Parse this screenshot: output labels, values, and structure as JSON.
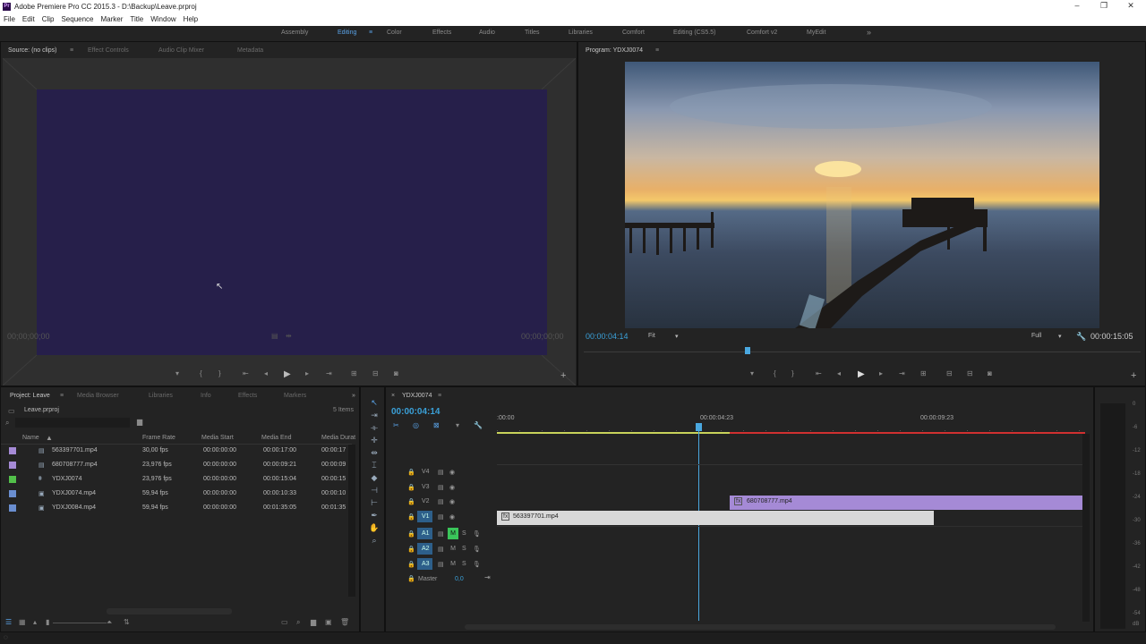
{
  "app": {
    "title": "Adobe Premiere Pro CC 2015.3 - D:\\Backup\\Leave.prproj",
    "icon": "Pr"
  },
  "window": {
    "min": "–",
    "max": "❐",
    "close": "✕"
  },
  "menu": [
    "File",
    "Edit",
    "Clip",
    "Sequence",
    "Marker",
    "Title",
    "Window",
    "Help"
  ],
  "workspaces": [
    "Assembly",
    "Editing",
    "Color",
    "Effects",
    "Audio",
    "Titles",
    "Libraries",
    "Comfort",
    "Editing (CS5.5)",
    "Comfort v2",
    "MyEdit"
  ],
  "workspace_more": "»",
  "source": {
    "tabs": [
      "Source: (no clips)",
      "Effect Controls",
      "Audio Clip Mixer",
      "Metadata"
    ],
    "menu_icon": "≡",
    "tc_in": "00;00;00;00",
    "tc_out": "00;00;00;00",
    "bg": "#261f4a"
  },
  "program": {
    "tab": "Program: YDXJ0074",
    "menu_icon": "≡",
    "tc_current": "00:00:04:14",
    "fit": "Fit",
    "quality": "Full",
    "tc_duration": "00:00:15:05"
  },
  "controls": {
    "marker": "▾",
    "in": "{",
    "out": "}",
    "goin": "⇤",
    "stepback": "◂",
    "play": "▶",
    "stepfwd": "▸",
    "goout": "⇥",
    "insert": "⊞",
    "overwrite": "⊟",
    "export": "◙",
    "add": "+"
  },
  "project": {
    "tabs": [
      "Project: Leave",
      "Media Browser",
      "Libraries",
      "Info",
      "Effects",
      "Markers"
    ],
    "more": "»",
    "file": "Leave.prproj",
    "items": "5 Items",
    "search_placeholder": "",
    "columns": [
      "Name",
      "Frame Rate",
      "Media Start",
      "Media End",
      "Media Durat"
    ],
    "rows": [
      {
        "name": "563397701.mp4",
        "rate": "30,00 fps",
        "start": "00:00:00:00",
        "end": "00:00:17:00",
        "dur": "00:00:17",
        "color": "#a58ad6",
        "icon": "film-icon"
      },
      {
        "name": "680708777.mp4",
        "rate": "23,976 fps",
        "start": "00:00:00:00",
        "end": "00:00:09:21",
        "dur": "00:00:09",
        "color": "#a58ad6",
        "icon": "film-icon"
      },
      {
        "name": "YDXJ0074",
        "rate": "23,976 fps",
        "start": "00:00:00:00",
        "end": "00:00:15:04",
        "dur": "00:00:15",
        "color": "#52c04a",
        "icon": "sequence-icon"
      },
      {
        "name": "YDXJ0074.mp4",
        "rate": "59,94 fps",
        "start": "00:00:00:00",
        "end": "00:00:10:33",
        "dur": "00:00:10",
        "color": "#6a8ed0",
        "icon": "clip-icon"
      },
      {
        "name": "YDXJ0084.mp4",
        "rate": "59,94 fps",
        "start": "00:00:00:00",
        "end": "00:01:35:05",
        "dur": "00:01:35",
        "color": "#6a8ed0",
        "icon": "clip-icon"
      }
    ]
  },
  "timeline": {
    "tab": "YDXJ0074",
    "menu_icon": "≡",
    "tc": "00:00:04:14",
    "ruler": [
      ":00:00",
      "00:00:04:23",
      "00:00:09:23"
    ],
    "tracks": [
      {
        "id": "V4"
      },
      {
        "id": "V3"
      },
      {
        "id": "V2"
      },
      {
        "id": "V1"
      },
      {
        "id": "A1"
      },
      {
        "id": "A2"
      },
      {
        "id": "A3"
      }
    ],
    "master": "Master",
    "master_val": "0,0",
    "m": "M",
    "s": "S",
    "clips": [
      {
        "name": "680708777.mp4",
        "fx": "fx",
        "color": "#a58ad6"
      },
      {
        "name": "563397701.mp4",
        "fx": "fx",
        "color": "#d8d8d8"
      }
    ]
  },
  "meter": {
    "labels": [
      "0",
      "-6",
      "-12",
      "-18",
      "-24",
      "-30",
      "-36",
      "-42",
      "-48",
      "-54"
    ],
    "db": "dB"
  },
  "colors": {
    "accent": "#3aa0d8",
    "v2": "#a58ad6",
    "v1": "#d8d8d8"
  }
}
